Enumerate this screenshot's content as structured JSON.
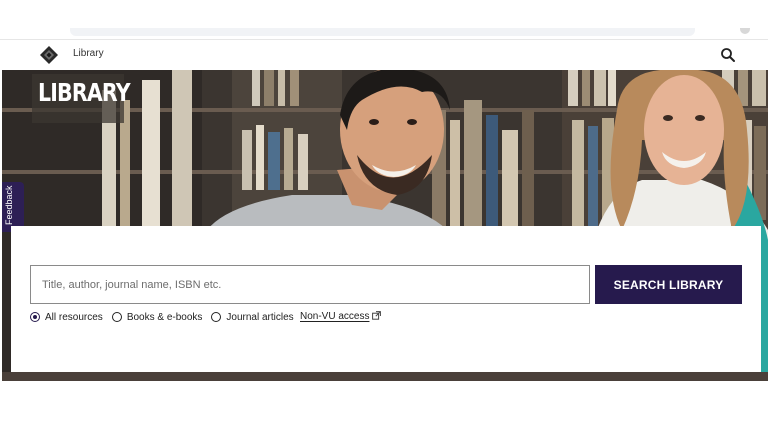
{
  "header": {
    "title": "Library"
  },
  "hero": {
    "title": "LIBRARY"
  },
  "feedback": {
    "label": "Feedback"
  },
  "search": {
    "placeholder": "Title, author, journal name, ISBN etc.",
    "value": "",
    "button_label": "SEARCH LIBRARY"
  },
  "filters": {
    "options": [
      {
        "label": "All resources",
        "checked": true
      },
      {
        "label": "Books & e-books",
        "checked": false
      },
      {
        "label": "Journal articles",
        "checked": false
      }
    ],
    "non_vu_link": "Non-VU access"
  },
  "colors": {
    "brand_dark": "#261a4d",
    "feedback_tab": "#2d1f55"
  },
  "icons": {
    "logo": "diamond-logo-icon",
    "search": "search-icon",
    "external": "external-link-icon"
  }
}
